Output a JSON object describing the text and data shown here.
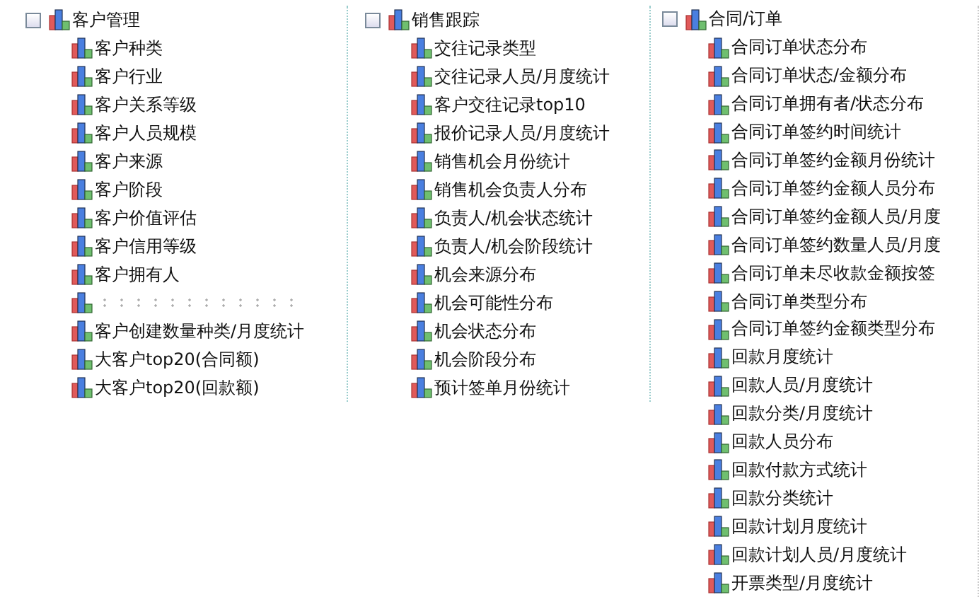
{
  "groups": [
    {
      "label": "客户管理",
      "expanded": true,
      "children": [
        {
          "label": "客户种类"
        },
        {
          "label": "客户行业"
        },
        {
          "label": "客户关系等级"
        },
        {
          "label": "客户人员规模"
        },
        {
          "label": "客户来源"
        },
        {
          "label": "客户阶段"
        },
        {
          "label": "客户价值评估"
        },
        {
          "label": "客户信用等级"
        },
        {
          "label": "客户拥有人"
        },
        {
          "kind": "blurred"
        },
        {
          "label": "客户创建数量种类/月度统计"
        },
        {
          "label": "大客户top20(合同额)"
        },
        {
          "label": "大客户top20(回款额)"
        }
      ]
    },
    {
      "label": "销售跟踪",
      "expanded": true,
      "children": [
        {
          "label": "交往记录类型"
        },
        {
          "label": "交往记录人员/月度统计"
        },
        {
          "label": "客户交往记录top10"
        },
        {
          "label": "报价记录人员/月度统计"
        },
        {
          "label": "销售机会月份统计"
        },
        {
          "label": "销售机会负责人分布"
        },
        {
          "label": "负责人/机会状态统计"
        },
        {
          "label": "负责人/机会阶段统计"
        },
        {
          "label": "机会来源分布"
        },
        {
          "label": "机会可能性分布"
        },
        {
          "label": "机会状态分布"
        },
        {
          "label": "机会阶段分布"
        },
        {
          "label": "预计签单月份统计"
        }
      ]
    },
    {
      "label": "合同/订单",
      "expanded": true,
      "children": [
        {
          "label": "合同订单状态分布"
        },
        {
          "label": "合同订单状态/金额分布"
        },
        {
          "label": "合同订单拥有者/状态分布"
        },
        {
          "label": "合同订单签约时间统计"
        },
        {
          "label": "合同订单签约金额月份统计"
        },
        {
          "label": "合同订单签约金额人员分布"
        },
        {
          "label": "合同订单签约金额人员/月度"
        },
        {
          "label": "合同订单签约数量人员/月度"
        },
        {
          "label": "合同订单未尽收款金额按签"
        },
        {
          "label": "合同订单类型分布"
        },
        {
          "label": "合同订单签约金额类型分布"
        },
        {
          "label": "回款月度统计"
        },
        {
          "label": "回款人员/月度统计"
        },
        {
          "label": "回款分类/月度统计"
        },
        {
          "label": "回款人员分布"
        },
        {
          "label": "回款付款方式统计"
        },
        {
          "label": "回款分类统计"
        },
        {
          "label": "回款计划月度统计"
        },
        {
          "label": "回款计划人员/月度统计"
        },
        {
          "label": "开票类型/月度统计"
        }
      ]
    }
  ]
}
